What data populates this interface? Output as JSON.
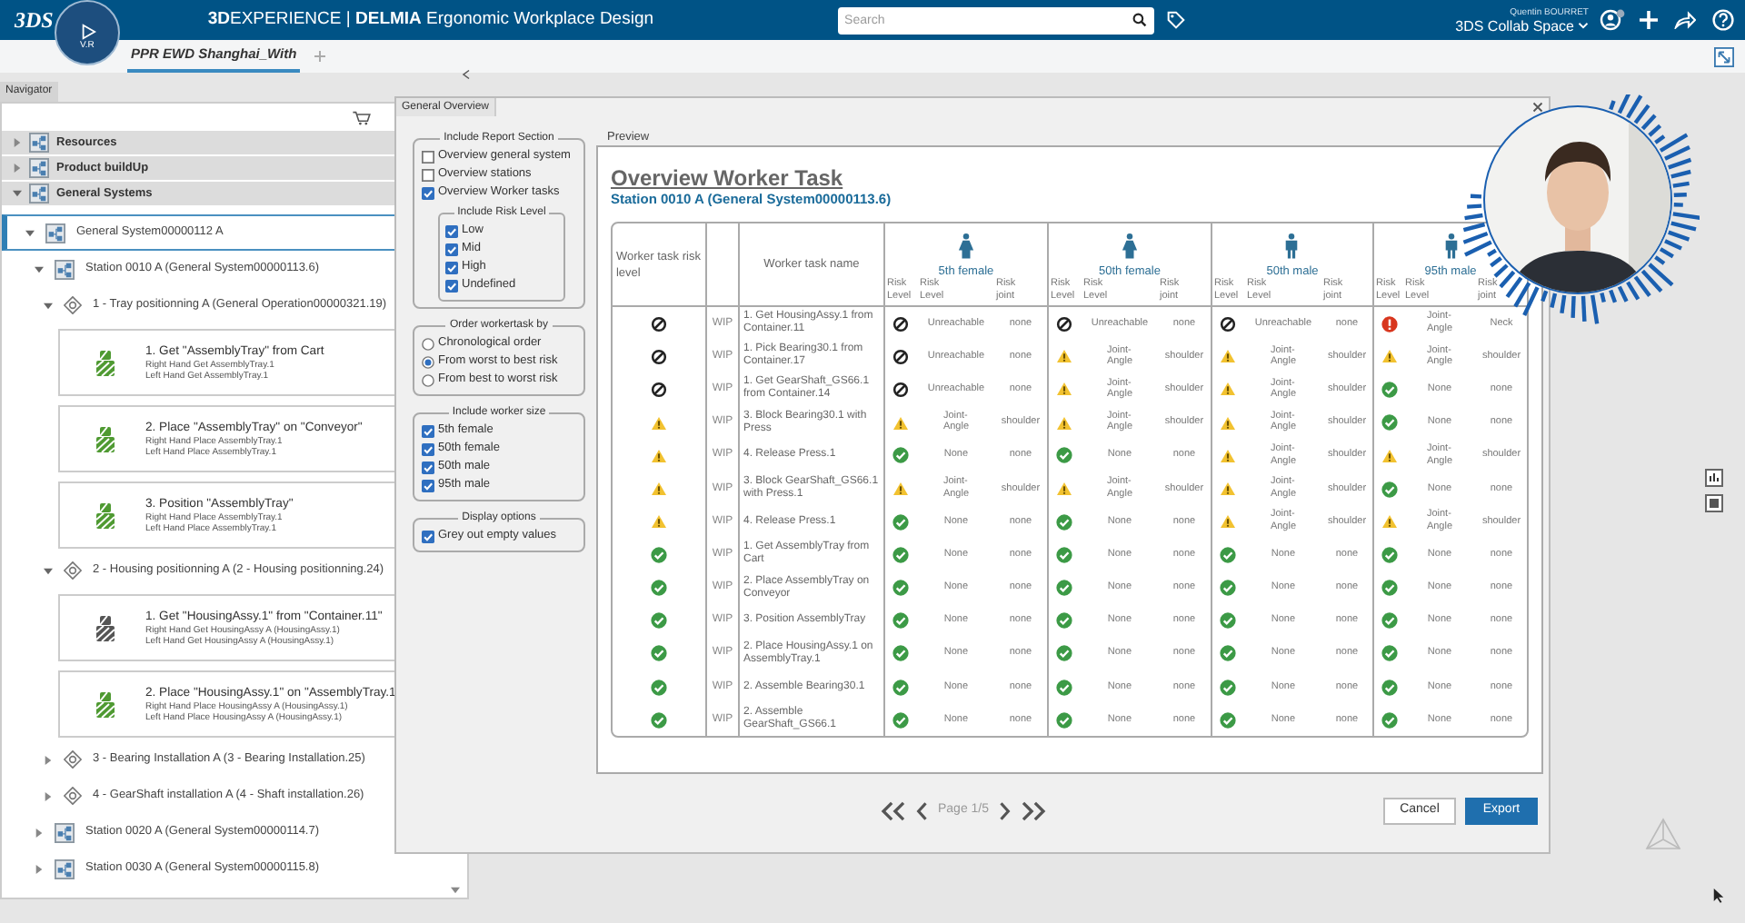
{
  "app_bar": {
    "logo": "3DS",
    "compass_label": "V.R",
    "title": "**3D**EXPERIENCE | **DELMIA** Ergonomic Workplace Design",
    "search": {
      "placeholder": "Search"
    },
    "user_name": "Quentin BOURRET",
    "space": "3DS Collab Space"
  },
  "doc_tabs": [
    {
      "label": "PPR EWD Shanghai_With",
      "selected": true
    }
  ],
  "navigator": {
    "tab": "Navigator",
    "tree": [
      {
        "kind": "section",
        "label": "Resources",
        "expanded": false,
        "selected": false
      },
      {
        "kind": "section",
        "label": "Product buildUp",
        "expanded": false,
        "selected": false
      },
      {
        "kind": "section",
        "label": "General Systems",
        "expanded": true,
        "selected": false,
        "children": [
          {
            "kind": "system",
            "label": "General System00000112 A",
            "expanded": true,
            "selected": true,
            "children": [
              {
                "kind": "system",
                "label": "Station 0010 A (General System00000113.6)",
                "expanded": true,
                "selected": false,
                "children": [
                  {
                    "kind": "operation",
                    "label": "1 - Tray positionning A (General Operation00000321.19)",
                    "expanded": true,
                    "selected": false,
                    "children": [
                      {
                        "kind": "task",
                        "label": "1. Get \"AssemblyTray\" from Cart",
                        "details": [
                          "Right Hand Get AssemblyTray.1",
                          "Left Hand Get AssemblyTray.1"
                        ],
                        "color": "#4f9a32",
                        "selected": false
                      },
                      {
                        "kind": "task",
                        "label": "2. Place \"AssemblyTray\" on \"Conveyor\"",
                        "details": [
                          "Right Hand Place AssemblyTray.1",
                          "Left Hand Place AssemblyTray.1"
                        ],
                        "color": "#4f9a32",
                        "selected": false
                      },
                      {
                        "kind": "task",
                        "label": "3. Position \"AssemblyTray\"",
                        "details": [
                          "Right Hand Place AssemblyTray.1",
                          "Left Hand Place AssemblyTray.1"
                        ],
                        "color": "#4f9a32",
                        "selected": false
                      }
                    ]
                  },
                  {
                    "kind": "operation",
                    "label": "2 - Housing positionning A (2 - Housing positionning.24)",
                    "expanded": true,
                    "selected": false,
                    "children": [
                      {
                        "kind": "task",
                        "label": "1. Get \"HousingAssy.1\" from \"Container.11\"",
                        "details": [
                          "Right Hand Get HousingAssy A (HousingAssy.1)",
                          "Left Hand Get HousingAssy A (HousingAssy.1)"
                        ],
                        "color": "#555555",
                        "selected": false
                      },
                      {
                        "kind": "task",
                        "label": "2. Place \"HousingAssy.1\" on \"AssemblyTray.1",
                        "details": [
                          "Right Hand Place HousingAssy A (HousingAssy.1)",
                          "Left Hand Place HousingAssy A (HousingAssy.1)"
                        ],
                        "color": "#4f9a32",
                        "selected": false
                      }
                    ]
                  },
                  {
                    "kind": "operation",
                    "label": "3 - Bearing Installation A (3 - Bearing Installation.25)",
                    "expanded": false,
                    "selected": false
                  },
                  {
                    "kind": "operation",
                    "label": "4 - GearShaft installation A (4 - Shaft installation.26)",
                    "expanded": false,
                    "selected": false
                  }
                ]
              },
              {
                "kind": "system",
                "label": "Station 0020 A (General System00000114.7)",
                "expanded": false,
                "selected": false
              },
              {
                "kind": "system",
                "label": "Station 0030 A (General System00000115.8)",
                "expanded": false,
                "selected": false
              }
            ]
          }
        ]
      }
    ]
  },
  "dialog": {
    "tab": "General Overview",
    "option_groups": [
      {
        "title": "Include Report Section",
        "options": [
          {
            "kind": "checkbox",
            "label": "Overview general system",
            "checked": false
          },
          {
            "kind": "checkbox",
            "label": "Overview stations",
            "checked": false
          },
          {
            "kind": "checkbox",
            "label": "Overview Worker tasks",
            "checked": true
          },
          {
            "kind": "group",
            "label": "Include Risk Level",
            "options": [
              {
                "kind": "checkbox",
                "label": "Low",
                "checked": true
              },
              {
                "kind": "checkbox",
                "label": "Mid",
                "checked": true
              },
              {
                "kind": "checkbox",
                "label": "High",
                "checked": true
              },
              {
                "kind": "checkbox",
                "label": "Undefined",
                "checked": true
              }
            ]
          }
        ]
      },
      {
        "title": "Order workertask by",
        "options": [
          {
            "kind": "radio",
            "label": "Chronological order",
            "selected": false
          },
          {
            "kind": "radio",
            "label": "From worst to best risk",
            "selected": true
          },
          {
            "kind": "radio",
            "label": "From best to worst risk",
            "selected": false
          }
        ]
      },
      {
        "title": "Include worker size",
        "options": [
          {
            "kind": "checkbox",
            "label": "5th female",
            "checked": true
          },
          {
            "kind": "checkbox",
            "label": "50th female",
            "checked": true
          },
          {
            "kind": "checkbox",
            "label": "50th male",
            "checked": true
          },
          {
            "kind": "checkbox",
            "label": "95th male",
            "checked": true
          }
        ]
      },
      {
        "title": "Display options",
        "options": [
          {
            "kind": "checkbox",
            "label": "Grey out empty values",
            "checked": true
          }
        ]
      }
    ],
    "preview": {
      "label": "Preview",
      "title": "Overview Worker Task",
      "subtitle": "Station 0010 A (General System00000113.6)",
      "table": {
        "columns": {
          "risk": "Worker task risk level",
          "name": "Worker task name",
          "sizes": [
            {
              "label": "5th female",
              "kind": "female",
              "subheads": [
                "Risk Level",
                "Risk Level",
                "Risk joint"
              ]
            },
            {
              "label": "50th female",
              "kind": "female",
              "subheads": [
                "Risk Level",
                "Risk Level",
                "Risk joint"
              ]
            },
            {
              "label": "50th male",
              "kind": "male",
              "subheads": [
                "Risk Level",
                "Risk Level",
                "Risk joint"
              ]
            },
            {
              "label": "95th male",
              "kind": "male",
              "subheads": [
                "Risk Level",
                "Risk Level",
                "Risk joint"
              ]
            }
          ]
        },
        "rows": [
          {
            "kind": "blocked",
            "status": "WIP",
            "name": "1. Get HousingAssy.1 from Container.11",
            "cells": [
              {
                "kind": "blocked",
                "type": "Unreachable",
                "joint": "none"
              },
              {
                "kind": "blocked",
                "type": "Unreachable",
                "joint": "none"
              },
              {
                "kind": "blocked",
                "type": "Unreachable",
                "joint": "none"
              },
              {
                "kind": "error",
                "type": "Joint-Angle",
                "joint": "Neck"
              }
            ]
          },
          {
            "kind": "blocked",
            "status": "WIP",
            "name": "1. Pick Bearing30.1 from Container.17",
            "cells": [
              {
                "kind": "blocked",
                "type": "Unreachable",
                "joint": "none"
              },
              {
                "kind": "warn",
                "type": "Joint-Angle",
                "joint": "shoulder"
              },
              {
                "kind": "warn",
                "type": "Joint-Angle",
                "joint": "shoulder"
              },
              {
                "kind": "warn",
                "type": "Joint-Angle",
                "joint": "shoulder"
              }
            ]
          },
          {
            "kind": "blocked",
            "status": "WIP",
            "name": "1. Get GearShaft_GS66.1 from Container.14",
            "cells": [
              {
                "kind": "blocked",
                "type": "Unreachable",
                "joint": "none"
              },
              {
                "kind": "warn",
                "type": "Joint-Angle",
                "joint": "shoulder"
              },
              {
                "kind": "warn",
                "type": "Joint-Angle",
                "joint": "shoulder"
              },
              {
                "kind": "ok",
                "type": "None",
                "joint": "none"
              }
            ]
          },
          {
            "kind": "warn",
            "status": "WIP",
            "name": "3. Block Bearing30.1 with Press",
            "cells": [
              {
                "kind": "warn",
                "type": "Joint-Angle",
                "joint": "shoulder"
              },
              {
                "kind": "warn",
                "type": "Joint-Angle",
                "joint": "shoulder"
              },
              {
                "kind": "warn",
                "type": "Joint-Angle",
                "joint": "shoulder"
              },
              {
                "kind": "ok",
                "type": "None",
                "joint": "none"
              }
            ]
          },
          {
            "kind": "warn",
            "status": "WIP",
            "name": "4. Release Press.1",
            "cells": [
              {
                "kind": "ok",
                "type": "None",
                "joint": "none"
              },
              {
                "kind": "ok",
                "type": "None",
                "joint": "none"
              },
              {
                "kind": "warn",
                "type": "Joint-Angle",
                "joint": "shoulder"
              },
              {
                "kind": "warn",
                "type": "Joint-Angle",
                "joint": "shoulder"
              }
            ]
          },
          {
            "kind": "warn",
            "status": "WIP",
            "name": "3. Block GearShaft_GS66.1 with Press.1",
            "cells": [
              {
                "kind": "warn",
                "type": "Joint-Angle",
                "joint": "shoulder"
              },
              {
                "kind": "warn",
                "type": "Joint-Angle",
                "joint": "shoulder"
              },
              {
                "kind": "warn",
                "type": "Joint-Angle",
                "joint": "shoulder"
              },
              {
                "kind": "ok",
                "type": "None",
                "joint": "none"
              }
            ]
          },
          {
            "kind": "warn",
            "status": "WIP",
            "name": "4. Release Press.1",
            "cells": [
              {
                "kind": "ok",
                "type": "None",
                "joint": "none"
              },
              {
                "kind": "ok",
                "type": "None",
                "joint": "none"
              },
              {
                "kind": "warn",
                "type": "Joint-Angle",
                "joint": "shoulder"
              },
              {
                "kind": "warn",
                "type": "Joint-Angle",
                "joint": "shoulder"
              }
            ]
          },
          {
            "kind": "ok",
            "status": "WIP",
            "name": "1. Get AssemblyTray from Cart",
            "cells": [
              {
                "kind": "ok",
                "type": "None",
                "joint": "none"
              },
              {
                "kind": "ok",
                "type": "None",
                "joint": "none"
              },
              {
                "kind": "ok",
                "type": "None",
                "joint": "none"
              },
              {
                "kind": "ok",
                "type": "None",
                "joint": "none"
              }
            ]
          },
          {
            "kind": "ok",
            "status": "WIP",
            "name": "2. Place AssemblyTray on Conveyor",
            "cells": [
              {
                "kind": "ok",
                "type": "None",
                "joint": "none"
              },
              {
                "kind": "ok",
                "type": "None",
                "joint": "none"
              },
              {
                "kind": "ok",
                "type": "None",
                "joint": "none"
              },
              {
                "kind": "ok",
                "type": "None",
                "joint": "none"
              }
            ]
          },
          {
            "kind": "ok",
            "status": "WIP",
            "name": "3. Position AssemblyTray",
            "cells": [
              {
                "kind": "ok",
                "type": "None",
                "joint": "none"
              },
              {
                "kind": "ok",
                "type": "None",
                "joint": "none"
              },
              {
                "kind": "ok",
                "type": "None",
                "joint": "none"
              },
              {
                "kind": "ok",
                "type": "None",
                "joint": "none"
              }
            ]
          },
          {
            "kind": "ok",
            "status": "WIP",
            "name": "2. Place HousingAssy.1 on AssemblyTray.1",
            "cells": [
              {
                "kind": "ok",
                "type": "None",
                "joint": "none"
              },
              {
                "kind": "ok",
                "type": "None",
                "joint": "none"
              },
              {
                "kind": "ok",
                "type": "None",
                "joint": "none"
              },
              {
                "kind": "ok",
                "type": "None",
                "joint": "none"
              }
            ]
          },
          {
            "kind": "ok",
            "status": "WIP",
            "name": "2. Assemble Bearing30.1",
            "cells": [
              {
                "kind": "ok",
                "type": "None",
                "joint": "none"
              },
              {
                "kind": "ok",
                "type": "None",
                "joint": "none"
              },
              {
                "kind": "ok",
                "type": "None",
                "joint": "none"
              },
              {
                "kind": "ok",
                "type": "None",
                "joint": "none"
              }
            ]
          },
          {
            "kind": "ok",
            "status": "WIP",
            "name": "2. Assemble GearShaft_GS66.1",
            "cells": [
              {
                "kind": "ok",
                "type": "None",
                "joint": "none"
              },
              {
                "kind": "ok",
                "type": "None",
                "joint": "none"
              },
              {
                "kind": "ok",
                "type": "None",
                "joint": "none"
              },
              {
                "kind": "ok",
                "type": "None",
                "joint": "none"
              }
            ]
          }
        ]
      }
    },
    "pagination": {
      "page": "Page 1/5"
    },
    "buttons": [
      {
        "label": "Cancel",
        "kind": "secondary"
      },
      {
        "label": "Export",
        "kind": "primary"
      }
    ]
  }
}
